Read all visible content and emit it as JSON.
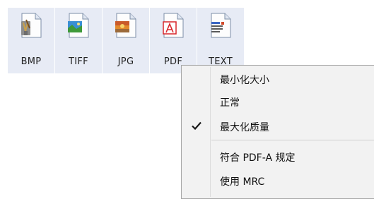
{
  "file_types": [
    {
      "label": "BMP",
      "icon": "bmp-file-icon"
    },
    {
      "label": "TIFF",
      "icon": "tiff-file-icon"
    },
    {
      "label": "JPG",
      "icon": "jpg-file-icon"
    },
    {
      "label": "PDF",
      "icon": "pdf-file-icon"
    },
    {
      "label": "TEXT",
      "icon": "text-file-icon"
    }
  ],
  "context_menu": {
    "items": [
      {
        "label": "最小化大小",
        "checked": false
      },
      {
        "label": "正常",
        "checked": false
      },
      {
        "label": "最大化质量",
        "checked": true
      },
      {
        "label": "符合 PDF-A 规定",
        "checked": false
      },
      {
        "label": "使用 MRC",
        "checked": false
      }
    ]
  },
  "colors": {
    "button_bg": "#e7ebf5",
    "menu_bg": "#f2f2f2",
    "pdf_red": "#d8262b"
  }
}
